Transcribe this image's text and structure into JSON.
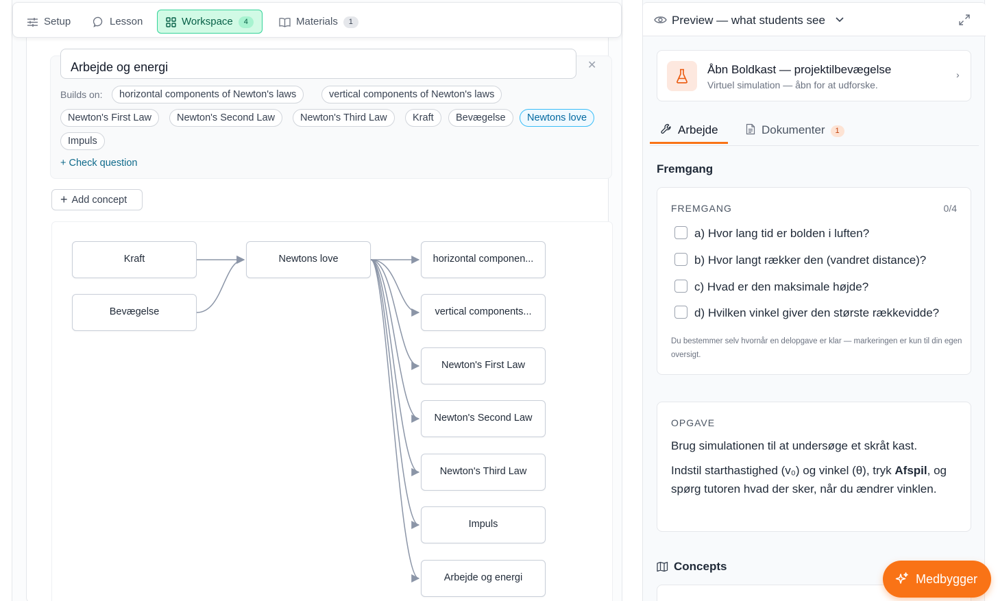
{
  "tabs": [
    {
      "label": "Setup",
      "icon": "sliders-icon"
    },
    {
      "label": "Lesson",
      "icon": "chat-bubble-icon"
    },
    {
      "label": "Workspace",
      "icon": "grid-icon",
      "badge": "4",
      "active": true
    },
    {
      "label": "Materials",
      "icon": "book-icon",
      "badge": "1"
    }
  ],
  "concept_editor": {
    "title_value": "Arbejde og energi",
    "builds_on_label": "Builds on:",
    "chips": [
      "horizontal components of Newton's laws",
      "vertical components of Newton's laws",
      "Newton's First Law",
      "Newton's Second Law",
      "Newton's Third Law",
      "Kraft",
      "Bevægelse",
      "Newtons love",
      "Impuls"
    ],
    "active_chip": "Newtons love",
    "check_question": "+ Check question"
  },
  "add_concept_label": "Add concept",
  "graph": {
    "sources": [
      "Kraft",
      "Bevægelse"
    ],
    "hub": "Newtons love",
    "targets": [
      "horizontal componen...",
      "vertical components...",
      "Newton's First Law",
      "Newton's Second Law",
      "Newton's Third Law",
      "Impuls",
      "Arbejde og energi"
    ]
  },
  "preview": {
    "header": "Preview — what students see",
    "simulation": {
      "title": "Åbn Boldkast — projektilbevægelse",
      "subtitle": "Virtuel simulation — åbn for at udforske.",
      "icon": "flask-icon"
    },
    "tabs": [
      {
        "label": "Arbejde",
        "icon": "wrench-icon",
        "active": true
      },
      {
        "label": "Dokumenter",
        "icon": "document-icon",
        "badge": "1"
      }
    ],
    "progress_heading": "Fremgang",
    "progress": {
      "label": "FREMGANG",
      "count": "0/4",
      "items": [
        "a) Hvor lang tid er bolden i luften?",
        "b) Hvor langt rækker den (vandret distance)?",
        "c) Hvad er den maksimale højde?",
        "d) Hvilken vinkel giver den største rækkevidde?"
      ],
      "note": "Du bestemmer selv hvornår en delopgave er klar — markeringen er kun til din egen oversigt."
    },
    "task": {
      "label": "OPGAVE",
      "line1": "Brug simulationen til at undersøge et skråt kast.",
      "line2_pre": "Indstil starthastighed (v₀) og vinkel (θ), tryk ",
      "line2_bold": "Afspil",
      "line2_post": ", og spørg tutoren hvad der sker, når du ændrer vinklen."
    },
    "concepts_heading": "Concepts"
  },
  "fab_label": "Medbygger",
  "colors": {
    "accent_green": "#34d399",
    "accent_orange": "#f97316",
    "active_chip": "#38bdf8",
    "edge": "#8b95a7"
  }
}
